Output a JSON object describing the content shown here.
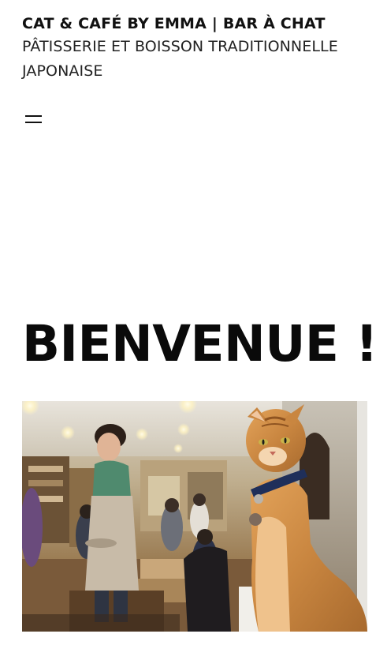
{
  "header": {
    "site_title": "CAT & CAFÉ BY EMMA | BAR À CHAT",
    "tagline": "PÂTISSERIE ET BOISSON TRADITIONNELLE JAPONAISE"
  },
  "nav": {
    "menu_icon": "hamburger-menu-icon"
  },
  "main": {
    "heading": "BIENVENUE !",
    "hero_image": "photo-orange-cat-in-cafe"
  },
  "colors": {
    "text": "#111111",
    "background": "#ffffff"
  }
}
